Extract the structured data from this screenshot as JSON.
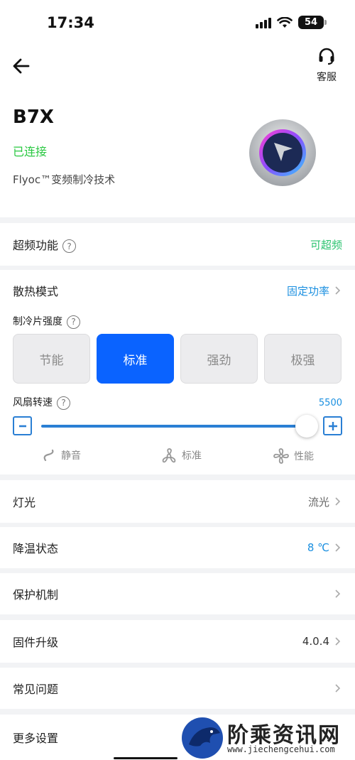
{
  "status_bar": {
    "time": "17:34",
    "battery": "54"
  },
  "header": {
    "service_label": "客服",
    "device_name": "B7X",
    "connection_status": "已连接",
    "tech_text": "Flyoc™变频制冷技术"
  },
  "overclock": {
    "label": "超频功能",
    "value": "可超频",
    "value_color": "#2bc36f"
  },
  "cooling": {
    "label": "散热模式",
    "value": "固定功率",
    "value_color": "#1a8fe0",
    "strength_label": "制冷片强度",
    "modes": [
      "节能",
      "标准",
      "强劲",
      "极强"
    ],
    "active_mode": "标准",
    "fan_label": "风扇转速",
    "fan_value": "5500",
    "fan_level": 1.0,
    "fan_presets": [
      "静音",
      "标准",
      "性能"
    ]
  },
  "rows": [
    {
      "label": "灯光",
      "value": "流光"
    },
    {
      "label": "降温状态",
      "value": "8 ℃"
    },
    {
      "label": "保护机制",
      "value": ""
    },
    {
      "label": "固件升级",
      "value": "4.0.4"
    },
    {
      "label": "常见问题",
      "value": ""
    },
    {
      "label": "更多设置",
      "value": ""
    }
  ],
  "watermark": {
    "text": "阶乘资讯网",
    "url": "www.jiechengcehui.com"
  },
  "colors": {
    "accent": "#0a63ff",
    "slider": "#2a7fd4",
    "connected": "#28c840"
  }
}
